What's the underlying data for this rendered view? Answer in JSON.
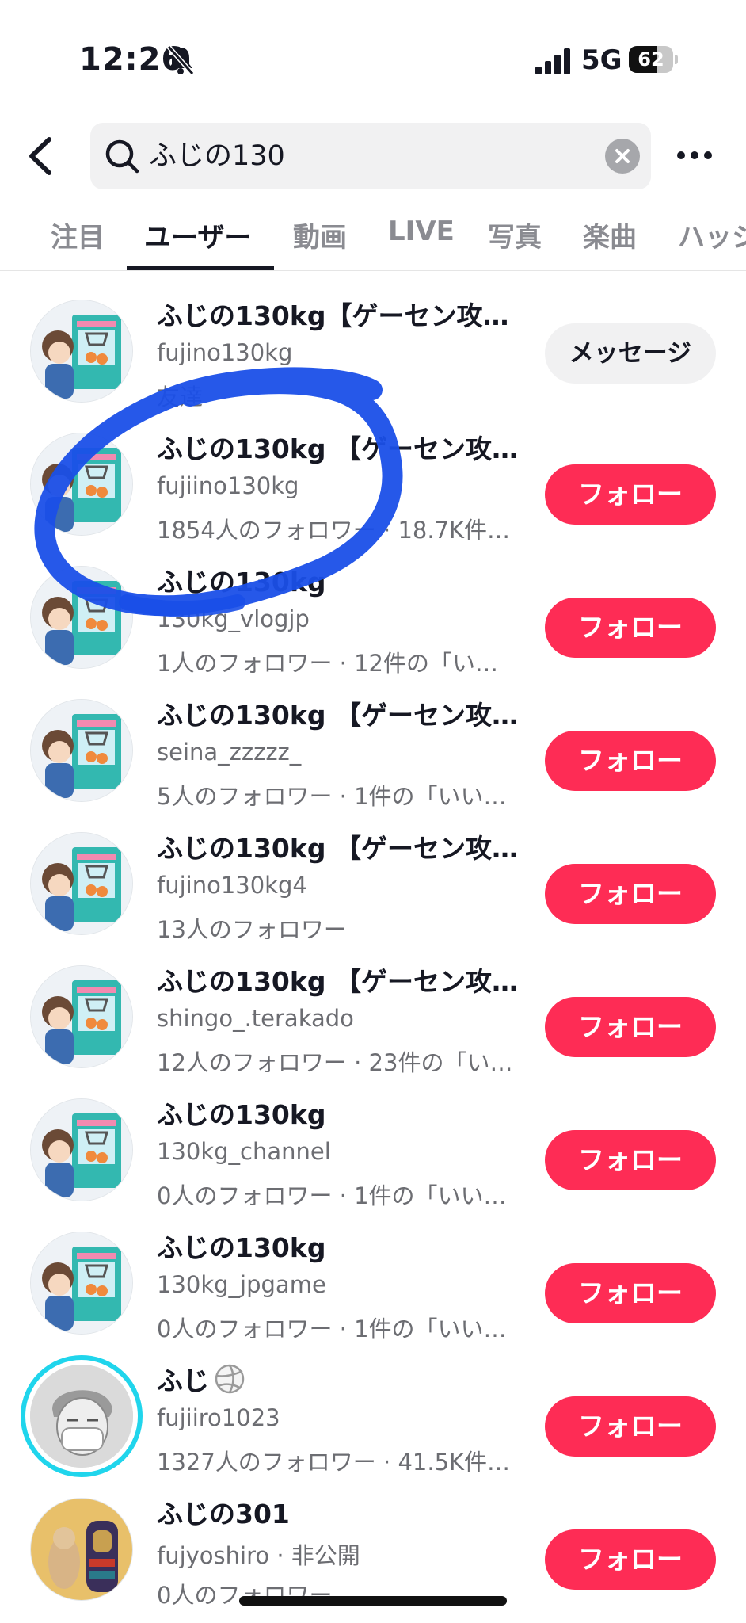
{
  "status_bar": {
    "time": "12:26",
    "network": "5G",
    "battery_level": "62"
  },
  "search": {
    "query": "ふじの130"
  },
  "tabs": [
    {
      "label": "注目"
    },
    {
      "label": "ユーザー"
    },
    {
      "label": "動画"
    },
    {
      "label": "LIVE"
    },
    {
      "label": "写真"
    },
    {
      "label": "楽曲"
    },
    {
      "label": "ハッシ"
    }
  ],
  "active_tab": "ユーザー",
  "users": [
    {
      "name": "ふじの130kg【ゲーセン攻…",
      "handle": "fujino130kg",
      "meta": "友達",
      "action": "メッセージ"
    },
    {
      "name": "ふじの130kg 【ゲーセン攻…",
      "handle": "fujiino130kg",
      "meta": "1854人のフォロワー · 18.7K件…",
      "action": "フォロー"
    },
    {
      "name": "ふじの130kg",
      "handle": "130kg_vlogjp",
      "meta": "1人のフォロワー · 12件の「い…",
      "action": "フォロー"
    },
    {
      "name": "ふじの130kg 【ゲーセン攻…",
      "handle": "seina_zzzzz_",
      "meta": "5人のフォロワー · 1件の「いい…",
      "action": "フォロー"
    },
    {
      "name": "ふじの130kg 【ゲーセン攻…",
      "handle": "fujino130kg4",
      "meta": "13人のフォロワー",
      "action": "フォロー"
    },
    {
      "name": "ふじの130kg 【ゲーセン攻…",
      "handle": "shingo_.terakado",
      "meta": "12人のフォロワー · 23件の「い…",
      "action": "フォロー"
    },
    {
      "name": "ふじの130kg",
      "handle": "130kg_channel",
      "meta": "0人のフォロワー · 1件の「いい…",
      "action": "フォロー"
    },
    {
      "name": "ふじの130kg",
      "handle": "130kg_jpgame",
      "meta": "0人のフォロワー · 1件の「いい…",
      "action": "フォロー"
    },
    {
      "name": "ふじ",
      "handle": "fujiiro1023",
      "meta": "1327人のフォロワー · 41.5K件…",
      "action": "フォロー"
    },
    {
      "name": "ふじの301",
      "handle": "fujyoshiro · 非公開",
      "meta": "0人のフォロワー",
      "action": "フォロー"
    }
  ],
  "colors": {
    "follow": "#fe2c55",
    "annotation": "#1a4fe8",
    "story_ring": "#20d5ec"
  }
}
